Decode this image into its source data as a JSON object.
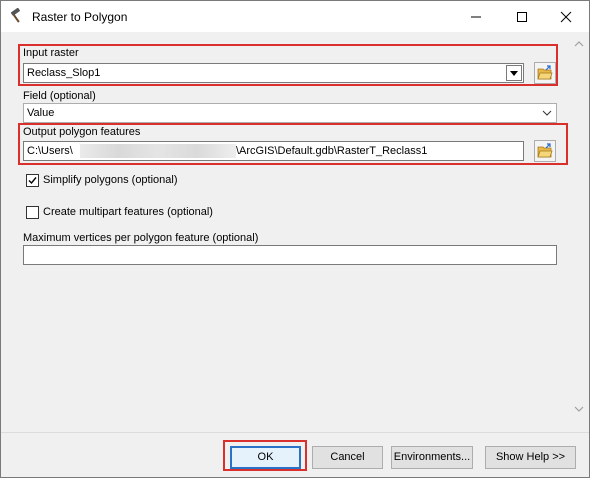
{
  "window": {
    "title": "Raster to Polygon",
    "icon": "hammer-icon"
  },
  "form": {
    "input_raster": {
      "label": "Input raster",
      "value": "Reclass_Slop1"
    },
    "field": {
      "label": "Field (optional)",
      "value": "Value"
    },
    "output_features": {
      "label": "Output polygon features",
      "value_prefix": "C:\\Users\\",
      "value_suffix": "\\ArcGIS\\Default.gdb\\RasterT_Reclass1"
    },
    "simplify": {
      "label": "Simplify polygons (optional)",
      "checked": true
    },
    "multipart": {
      "label": "Create multipart features (optional)",
      "checked": false
    },
    "max_vertices": {
      "label": "Maximum vertices per polygon feature (optional)",
      "value": ""
    }
  },
  "buttons": {
    "ok": "OK",
    "cancel": "Cancel",
    "environments": "Environments...",
    "show_help": "Show Help >>"
  },
  "colors": {
    "highlight": "#d9302e",
    "default_button_border": "#2a72c8"
  }
}
